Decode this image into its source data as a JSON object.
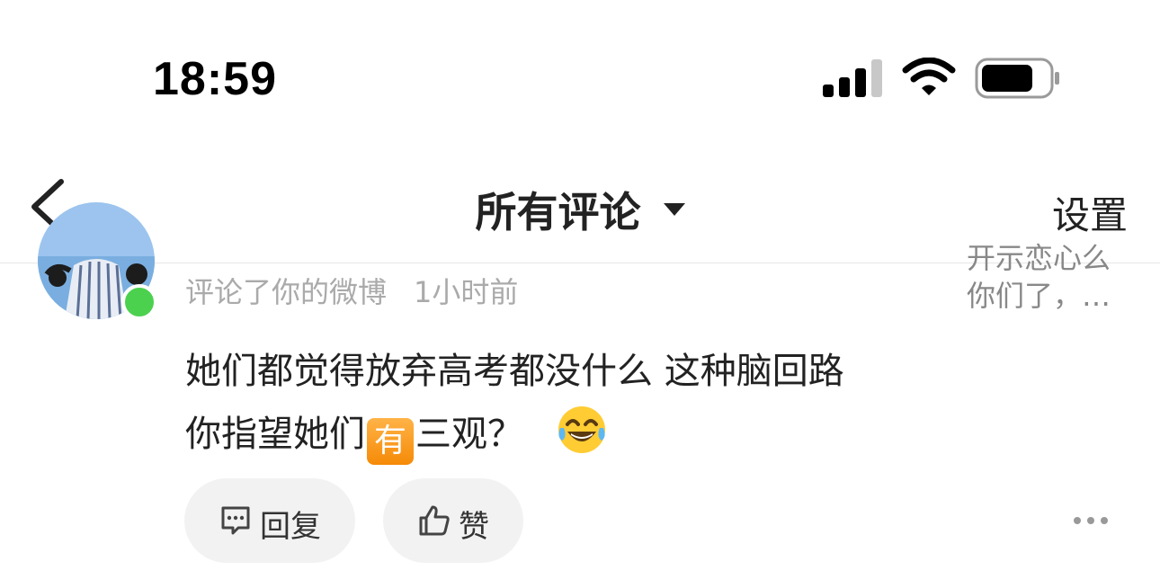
{
  "status_bar": {
    "time": "18:59",
    "signal_icon": "cellular-signal-icon",
    "wifi_icon": "wifi-icon",
    "battery_icon": "battery-icon"
  },
  "nav": {
    "back_icon": "chevron-left-icon",
    "title": "所有评论",
    "dropdown_icon": "caret-down-icon",
    "settings_label": "设置"
  },
  "comment": {
    "meta_action": "评论了你的微博",
    "time_ago": "1小时前",
    "preview_line1": "开示恋心么",
    "preview_line2": "你们了，…",
    "line1": "她们都觉得放弃高考都没什么 这种脑回路",
    "line2_prefix": "你指望她们",
    "line2_badge": "有",
    "line2_suffix": "三观？",
    "emoji_icon": "tears-of-joy-emoji-icon",
    "online_color": "#4cd14f"
  },
  "actions": {
    "reply_label": "回复",
    "reply_icon": "comment-icon",
    "like_label": "赞",
    "like_icon": "thumbs-up-icon",
    "more_icon": "more-icon"
  }
}
